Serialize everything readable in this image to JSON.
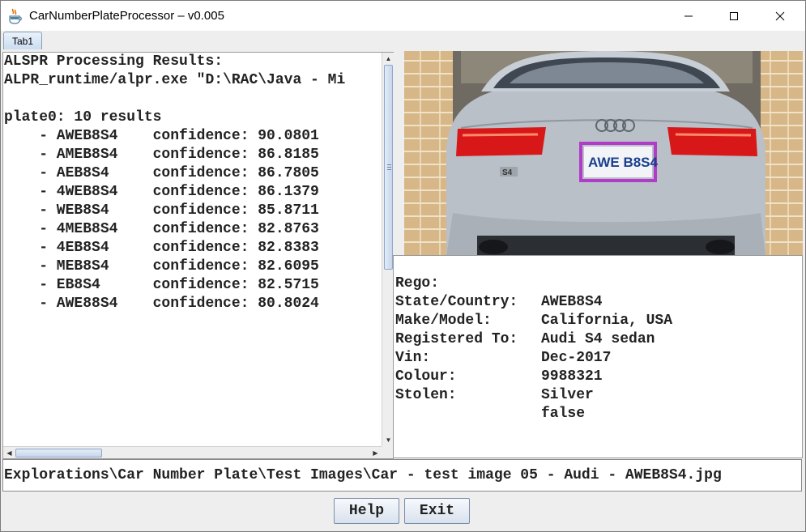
{
  "window": {
    "title": "CarNumberPlateProcessor – v0.005",
    "icon": "java-cup-icon",
    "controls": {
      "minimize": "—",
      "maximize": "☐",
      "close": "✕"
    }
  },
  "tabs": [
    {
      "label": "Tab1",
      "selected": true
    }
  ],
  "results": {
    "lines": [
      "ALSPR Processing Results:",
      "ALPR_runtime/alpr.exe \"D:\\RAC\\Java - Mi",
      "",
      "plate0: 10 results",
      "    - AWEB8S4    confidence: 90.0801",
      "    - AMEB8S4    confidence: 86.8185",
      "    - AEB8S4     confidence: 86.7805",
      "    - 4WEB8S4    confidence: 86.1379",
      "    - WEB8S4     confidence: 85.8711",
      "    - 4MEB8S4    confidence: 82.8763",
      "    - 4EB8S4     confidence: 82.8383",
      "    - MEB8S4     confidence: 82.6095",
      "    - EB8S4      confidence: 82.5715",
      "    - AWE88S4    confidence: 80.8024"
    ]
  },
  "image": {
    "plate_text": "AWE B8S4",
    "badge_text": "S4"
  },
  "details": [
    {
      "label": "Rego:",
      "value": "AWEB8S4"
    },
    {
      "label": "State/Country:",
      "value": "California, USA"
    },
    {
      "label": "Make/Model:",
      "value": "Audi S4 sedan"
    },
    {
      "label": "Registered To:",
      "value": "Dec-2017"
    },
    {
      "label": "Vin:",
      "value": "9988321"
    },
    {
      "label": "Colour:",
      "value": "Silver"
    },
    {
      "label": "Stolen:",
      "value": "false"
    }
  ],
  "path": "Explorations\\Car Number Plate\\Test Images\\Car - test image 05 - Audi - AWEB8S4.jpg",
  "buttons": {
    "help": "Help",
    "exit": "Exit"
  },
  "colors": {
    "highlight_box": "#b03cc8",
    "plate_text": "#1a3f8f",
    "taillight": "#d81818",
    "car_body": "#b9c0c8"
  }
}
